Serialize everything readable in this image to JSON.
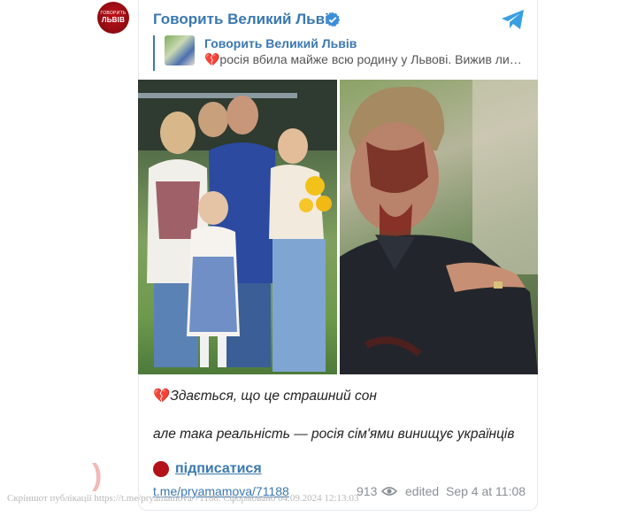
{
  "channel": {
    "avatar_line1": "Говорить",
    "avatar_line2": "Великий Львів",
    "title": "Говорить Великий Львів"
  },
  "reply": {
    "name": "Говорить Великий Львів",
    "text": "💔росія вбила майже всю родину у Львові. Вижив ли…"
  },
  "message": {
    "line1_emoji": "💔",
    "line1": "Здається, що це страшний сон",
    "line2": "але така реальність — росія сім'ями винищує українців"
  },
  "subscribe_label": "підписатися",
  "post_link": "t.me/pryamamova/71188",
  "views": "913",
  "edited_label": "edited",
  "date_label": "Sep 4 at 11:08",
  "watermark": "Скріншот публікації https://t.me/pryamamova/71188. Сформовано 04.09.2024 12:13:03",
  "icons": {
    "verified": "verified-badge-icon",
    "telegram": "telegram-plane-icon",
    "eye": "eye-icon"
  },
  "colors": {
    "accent": "#3a78b0",
    "avatar": "#b3121b",
    "meta": "#8a8f96"
  }
}
